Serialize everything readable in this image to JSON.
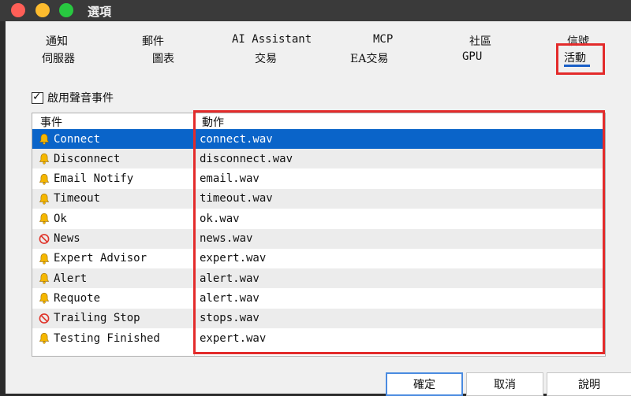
{
  "window": {
    "title": "選項"
  },
  "tabs": {
    "row1": [
      "通知",
      "郵件",
      "AI Assistant",
      "MCP",
      "社區",
      "信號"
    ],
    "row2": [
      "伺服器",
      "圖表",
      "交易",
      "EA交易",
      "GPU",
      "活動"
    ],
    "active": "活動"
  },
  "enable_sound": {
    "label": "啟用聲音事件",
    "checked": true
  },
  "table": {
    "headers": {
      "event": "事件",
      "action": "動作"
    },
    "rows": [
      {
        "event": "Connect",
        "action": "connect.wav",
        "icon": "bell-icon",
        "selected": true
      },
      {
        "event": "Disconnect",
        "action": "disconnect.wav",
        "icon": "bell-icon"
      },
      {
        "event": "Email Notify",
        "action": "email.wav",
        "icon": "bell-icon"
      },
      {
        "event": "Timeout",
        "action": "timeout.wav",
        "icon": "bell-icon"
      },
      {
        "event": "Ok",
        "action": "ok.wav",
        "icon": "bell-icon"
      },
      {
        "event": "News",
        "action": "news.wav",
        "icon": "disabled-icon"
      },
      {
        "event": "Expert Advisor",
        "action": "expert.wav",
        "icon": "bell-icon"
      },
      {
        "event": "Alert",
        "action": "alert.wav",
        "icon": "bell-icon"
      },
      {
        "event": "Requote",
        "action": "alert.wav",
        "icon": "bell-icon"
      },
      {
        "event": "Trailing Stop",
        "action": "stops.wav",
        "icon": "disabled-icon"
      },
      {
        "event": "Testing Finished",
        "action": "expert.wav",
        "icon": "bell-icon"
      }
    ]
  },
  "buttons": {
    "ok": "確定",
    "cancel": "取消",
    "help": "說明"
  },
  "colors": {
    "selection": "#0a64c9",
    "highlight_box": "#e32b2b",
    "bell": "#f5b700",
    "disabled": "#e0352b"
  }
}
